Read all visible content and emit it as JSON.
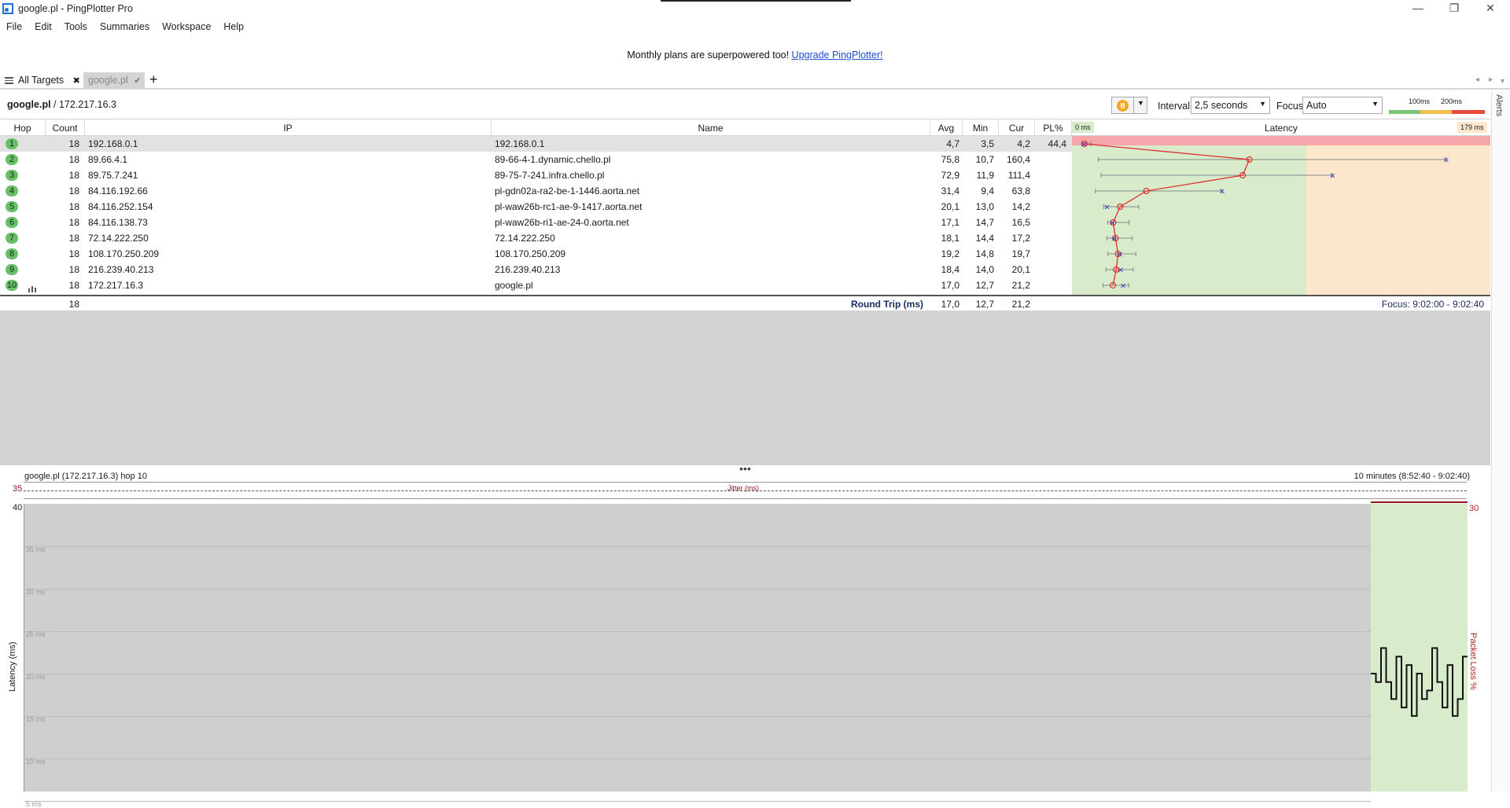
{
  "window": {
    "title": "google.pl - PingPlotter Pro",
    "minimize": "—",
    "restore": "❐",
    "close": "✕"
  },
  "menu": [
    "File",
    "Edit",
    "Tools",
    "Summaries",
    "Workspace",
    "Help"
  ],
  "promo": {
    "text": "Monthly plans are superpowered too! ",
    "link": "Upgrade PingPlotter!"
  },
  "tabs": {
    "all_targets": "All Targets",
    "close_glyph": "✖",
    "target": "google.pl",
    "check_glyph": "✔",
    "add": "+"
  },
  "target": {
    "name": "google.pl",
    "ip": " / 172.217.16.3"
  },
  "controls": {
    "interval_label": "Interval",
    "interval_value": "2,5 seconds",
    "focus_label": "Focus",
    "focus_value": "Auto",
    "legend_100": "100ms",
    "legend_200": "200ms",
    "colors": {
      "green": "#7cc576",
      "yellow": "#f2c14e",
      "red": "#e84b3c"
    }
  },
  "alerts_label": "Alerts",
  "table": {
    "headers": {
      "hop": "Hop",
      "count": "Count",
      "ip": "IP",
      "name": "Name",
      "avg": "Avg",
      "min": "Min",
      "cur": "Cur",
      "pl": "PL%",
      "latency": "Latency",
      "lat_min": "0 ms",
      "lat_max": "179 ms"
    },
    "rows": [
      {
        "hop": "1",
        "count": "18",
        "ip": "192.168.0.1",
        "name": "192.168.0.1",
        "avg": "4,7",
        "min": "3,5",
        "cur": "4,2",
        "pl": "44,4"
      },
      {
        "hop": "2",
        "count": "18",
        "ip": "89.66.4.1",
        "name": "89-66-4-1.dynamic.chello.pl",
        "avg": "75,8",
        "min": "10,7",
        "cur": "160,4",
        "pl": ""
      },
      {
        "hop": "3",
        "count": "18",
        "ip": "89.75.7.241",
        "name": "89-75-7-241.infra.chello.pl",
        "avg": "72,9",
        "min": "11,9",
        "cur": "111,4",
        "pl": ""
      },
      {
        "hop": "4",
        "count": "18",
        "ip": "84.116.192.66",
        "name": "pl-gdn02a-ra2-be-1-1446.aorta.net",
        "avg": "31,4",
        "min": "9,4",
        "cur": "63,8",
        "pl": ""
      },
      {
        "hop": "5",
        "count": "18",
        "ip": "84.116.252.154",
        "name": "pl-waw26b-rc1-ae-9-1417.aorta.net",
        "avg": "20,1",
        "min": "13,0",
        "cur": "14,2",
        "pl": ""
      },
      {
        "hop": "6",
        "count": "18",
        "ip": "84.116.138.73",
        "name": "pl-waw26b-ri1-ae-24-0.aorta.net",
        "avg": "17,1",
        "min": "14,7",
        "cur": "16,5",
        "pl": ""
      },
      {
        "hop": "7",
        "count": "18",
        "ip": "72.14.222.250",
        "name": "72.14.222.250",
        "avg": "18,1",
        "min": "14,4",
        "cur": "17,2",
        "pl": ""
      },
      {
        "hop": "8",
        "count": "18",
        "ip": "108.170.250.209",
        "name": "108.170.250.209",
        "avg": "19,2",
        "min": "14,8",
        "cur": "19,7",
        "pl": ""
      },
      {
        "hop": "9",
        "count": "18",
        "ip": "216.239.40.213",
        "name": "216.239.40.213",
        "avg": "18,4",
        "min": "14,0",
        "cur": "20,1",
        "pl": ""
      },
      {
        "hop": "10",
        "count": "18",
        "ip": "172.217.16.3",
        "name": "google.pl",
        "avg": "17,0",
        "min": "12,7",
        "cur": "21,2",
        "pl": ""
      }
    ],
    "summary": {
      "count": "18",
      "label": "Round Trip (ms)",
      "avg": "17,0",
      "min": "12,7",
      "cur": "21,2",
      "focus": "Focus: 9:02:00 - 9:02:40"
    }
  },
  "bottom": {
    "header": "google.pl (172.217.16.3) hop 10",
    "range": "10 minutes (8:52:40 - 9:02:40)",
    "jitter_label": "Jitter (ms)",
    "jitter_max": "35",
    "lat_max": "40",
    "pl_max": "30",
    "y_title": "Latency (ms)",
    "pl_title": "Packet Loss %",
    "grid": [
      "35 ms",
      "30 ms",
      "25 ms",
      "20 ms",
      "15 ms",
      "10 ms",
      "5 ms"
    ]
  }
}
